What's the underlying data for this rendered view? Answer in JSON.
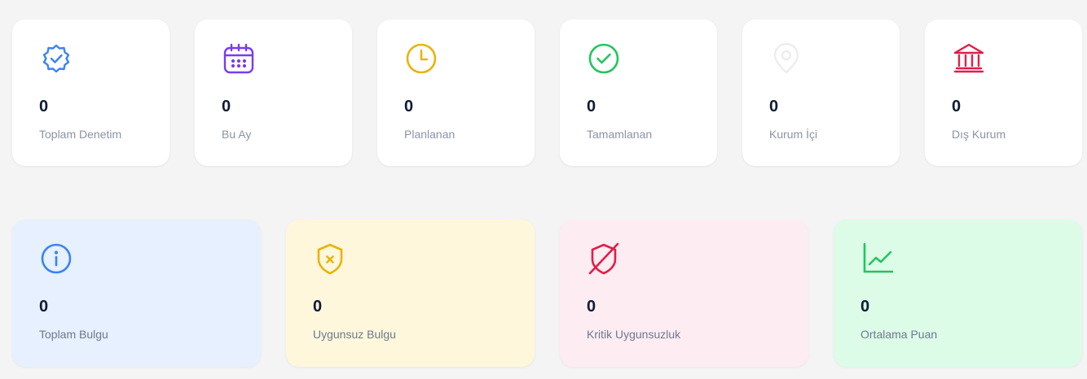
{
  "top_stats": [
    {
      "label": "Toplam Denetim",
      "value": "0",
      "icon": "verified-badge-icon",
      "color": "#3b82f6"
    },
    {
      "label": "Bu Ay",
      "value": "0",
      "icon": "calendar-icon",
      "color": "#7c3aed"
    },
    {
      "label": "Planlanan",
      "value": "0",
      "icon": "clock-icon",
      "color": "#eab308"
    },
    {
      "label": "Tamamlanan",
      "value": "0",
      "icon": "check-circle-icon",
      "color": "#22c55e"
    },
    {
      "label": "Kurum İçi",
      "value": "0",
      "icon": "location-pin-icon",
      "color": "#f1f1f3"
    },
    {
      "label": "Dış Kurum",
      "value": "0",
      "icon": "bank-icon",
      "color": "#e11d48"
    }
  ],
  "bottom_stats": [
    {
      "label": "Toplam Bulgu",
      "value": "0",
      "icon": "info-circle-icon",
      "color": "#3b82f6",
      "background": "#e6f0fe"
    },
    {
      "label": "Uygunsuz Bulgu",
      "value": "0",
      "icon": "shield-x-icon",
      "color": "#eab308",
      "background": "#fef7dc"
    },
    {
      "label": "Kritik Uygunsuzluk",
      "value": "0",
      "icon": "shield-off-icon",
      "color": "#e11d48",
      "background": "#fdecf2"
    },
    {
      "label": "Ortalama Puan",
      "value": "0",
      "icon": "line-chart-icon",
      "color": "#22c55e",
      "background": "#dcfce7"
    }
  ]
}
